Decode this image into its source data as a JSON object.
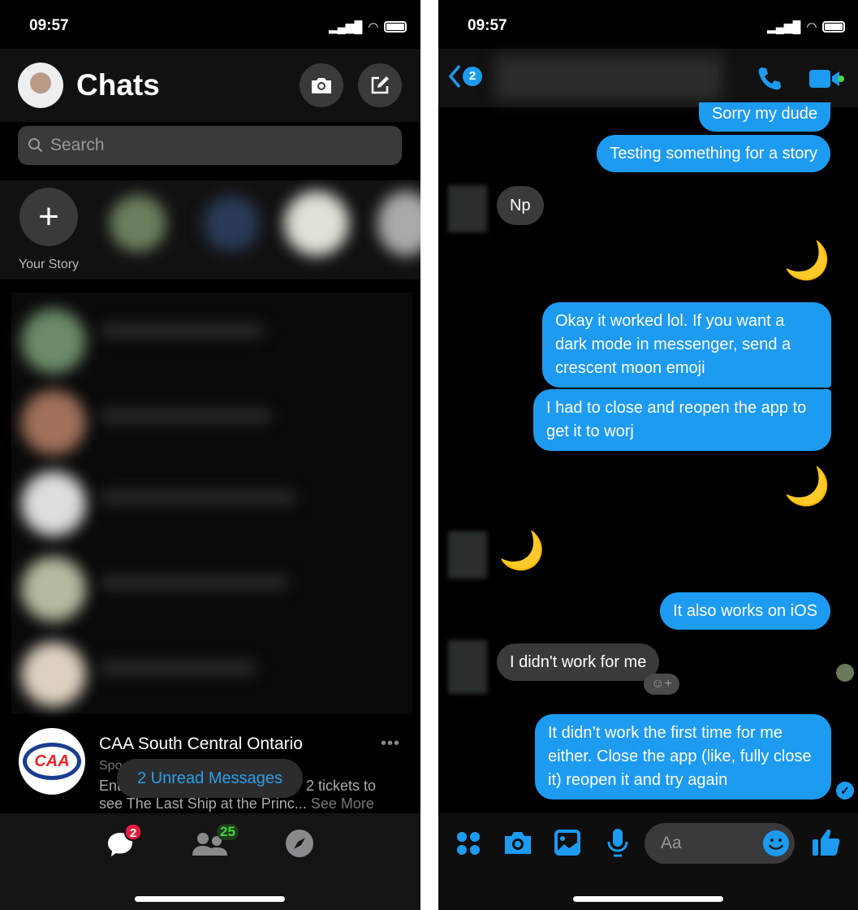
{
  "left": {
    "status": {
      "time": "09:57"
    },
    "header": {
      "title": "Chats",
      "camera_icon": "camera-icon",
      "compose_icon": "compose-icon"
    },
    "search": {
      "placeholder": "Search"
    },
    "stories": {
      "your_story": "Your Story"
    },
    "sponsored": {
      "name": "CAA South Central Ontario",
      "label": "Spo",
      "line1_start": "Ent",
      "line1_end": "2 tickets to",
      "line2": "see The Last Ship at the Princ...",
      "see_more": "See More",
      "logo_text": "CAA"
    },
    "toast": "2 Unread Messages",
    "nav": {
      "chats_badge": "2",
      "people_badge": "25"
    }
  },
  "right": {
    "status": {
      "time": "09:57"
    },
    "header": {
      "back_badge": "2"
    },
    "messages": [
      {
        "dir": "out",
        "text": "Sorry my dude"
      },
      {
        "dir": "out",
        "text": "Testing something for a story"
      },
      {
        "dir": "in",
        "text": "Np"
      },
      {
        "dir": "out",
        "text": "🌙"
      },
      {
        "dir": "out",
        "text": "Okay it worked lol. If you want a dark mode in messenger, send a crescent moon emoji"
      },
      {
        "dir": "out",
        "text": "I had to close and reopen the app to get it to worj"
      },
      {
        "dir": "out",
        "text": "🌙"
      },
      {
        "dir": "in",
        "text": "🌙"
      },
      {
        "dir": "out",
        "text": "It also works on iOS"
      },
      {
        "dir": "in",
        "text": "I didn't work for me"
      },
      {
        "dir": "out",
        "text": "It didn’t work the first time for me either. Close the app (like, fully close it) reopen it and try again"
      }
    ],
    "composer": {
      "placeholder": "Aa"
    }
  },
  "colors": {
    "accent": "#1d9bf0",
    "badge_red": "#e41e3f",
    "badge_green": "#4cd440"
  }
}
